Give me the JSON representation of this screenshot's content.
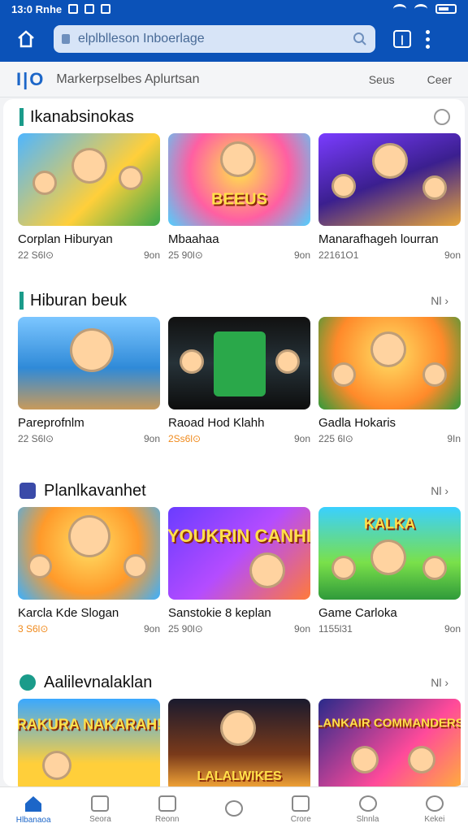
{
  "status": {
    "time": "13:0 Rnhe"
  },
  "browser": {
    "url": "elplblleson Inboerlage"
  },
  "subheader": {
    "logo": "I|O",
    "title": "Markerpselbes Aplurtsan",
    "link1": "Seus",
    "link2": "Ceer"
  },
  "sections": [
    {
      "title": "Ikanabsinokas",
      "cards": [
        {
          "name": "Corplan Hiburyan",
          "meta_left": "22 S6l⊙",
          "meta_right": "9on"
        },
        {
          "name": "Mbaahaa",
          "meta_left": "25 90l⊙",
          "meta_right": "9on"
        },
        {
          "name": "Manarafhageh lourran",
          "meta_left": "22161O1",
          "meta_right": "9on"
        }
      ]
    },
    {
      "title": "Hiburan beuk",
      "more": "Nl",
      "cards": [
        {
          "name": "Pareprofnlm",
          "meta_left": "22 S6l⊙",
          "meta_right": "9on"
        },
        {
          "name": "Raoad Hod Klahh",
          "meta_left": "2Ss6l⊙",
          "meta_right": "9on"
        },
        {
          "name": "Gadla Hokaris",
          "meta_left": "225 6l⊙",
          "meta_right": "9In"
        }
      ]
    },
    {
      "title": "Planlkavanhet",
      "more": "Nl",
      "cards": [
        {
          "name": "Karcla Kde Slogan",
          "meta_left": "3 S6l⊙",
          "meta_right": "9on"
        },
        {
          "name": "Sanstokie 8 keplan",
          "meta_left": "25 90l⊙",
          "meta_right": "9on"
        },
        {
          "name": "Game Carloka",
          "meta_left": "1155l31",
          "meta_right": "9on"
        }
      ]
    },
    {
      "title": "Aalilevnalaklan",
      "more": "Nl",
      "cards": [
        {
          "name": "",
          "emblem": "RAKURA NAKARAH!"
        },
        {
          "name": "",
          "emblem": "LALALWIKES"
        },
        {
          "name": "",
          "emblem": "LANKAIR COMMANDERS"
        }
      ]
    }
  ],
  "thumb_emblems": [
    "",
    "BEEUS",
    "",
    "",
    "",
    "",
    "",
    "YOUKRIN CANHI",
    "KALKA"
  ],
  "bottom_nav": [
    {
      "label": "Hlbanaoa"
    },
    {
      "label": "Seora"
    },
    {
      "label": "Reonn"
    },
    {
      "label": ""
    },
    {
      "label": "Crore"
    },
    {
      "label": "Slnnla"
    },
    {
      "label": "Kekei"
    }
  ],
  "colors": {
    "brand": "#0b52b8",
    "accent": "#1a9b8a",
    "highlight": "#f08a1c"
  }
}
